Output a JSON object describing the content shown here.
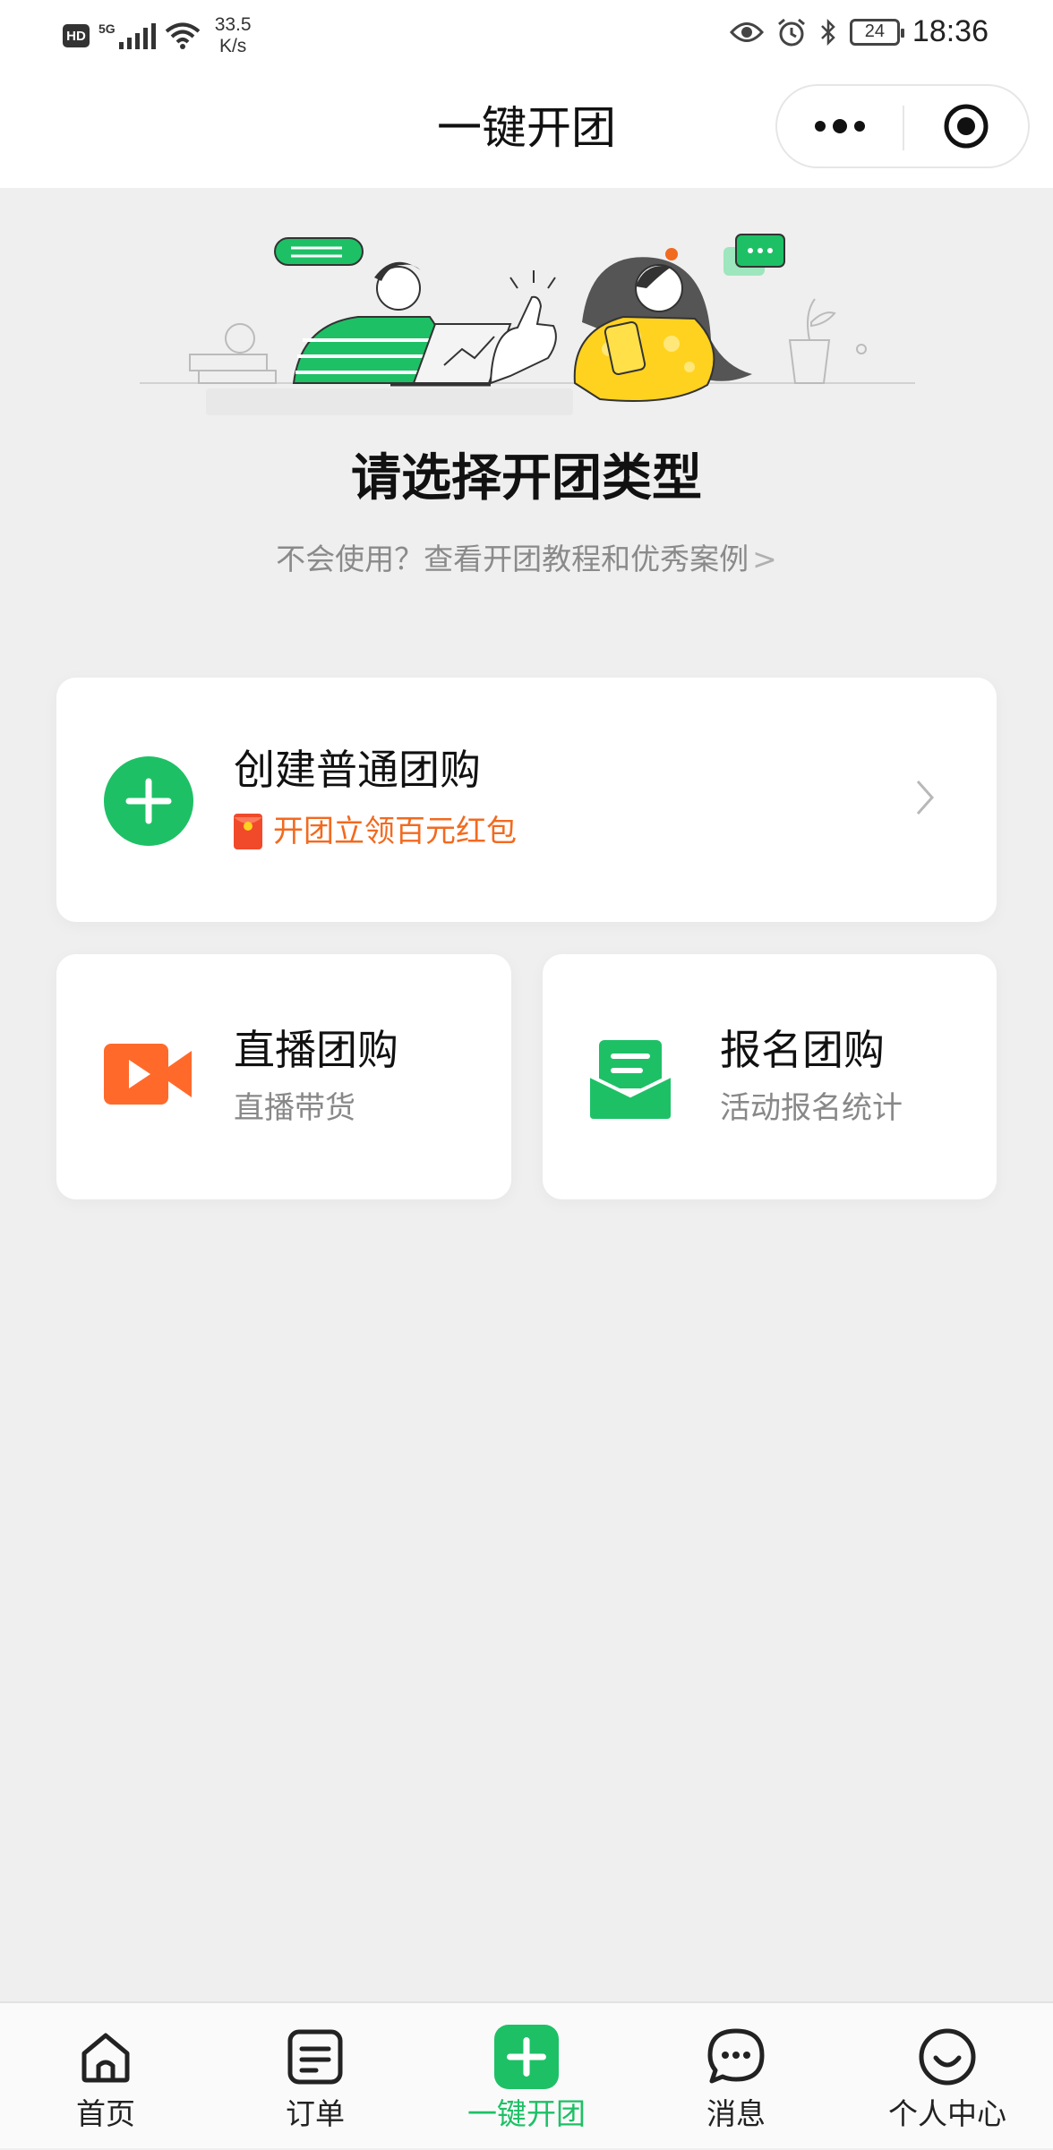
{
  "status_bar": {
    "hd": "HD",
    "network": "5G",
    "speed_value": "33.5",
    "speed_unit": "K/s",
    "battery": "24",
    "time": "18:36"
  },
  "header": {
    "title": "一键开团"
  },
  "hero": {
    "title": "请选择开团类型",
    "subtitle": "不会使用？查看开团教程和优秀案例",
    "subtitle_chevron": ">"
  },
  "cards": {
    "normal": {
      "title": "创建普通团购",
      "promo": "开团立领百元红包"
    },
    "live": {
      "title": "直播团购",
      "desc": "直播带货"
    },
    "signup": {
      "title": "报名团购",
      "desc": "活动报名统计"
    }
  },
  "tabbar": {
    "items": [
      {
        "label": "首页",
        "icon": "home-icon"
      },
      {
        "label": "订单",
        "icon": "order-icon"
      },
      {
        "label": "一键开团",
        "icon": "plus-square-icon",
        "active": true
      },
      {
        "label": "消息",
        "icon": "message-icon"
      },
      {
        "label": "个人中心",
        "icon": "profile-icon"
      }
    ]
  },
  "colors": {
    "accent_green": "#1ec066",
    "promo_orange": "#f26a1f",
    "live_icon_orange": "#ff6a2b",
    "background": "#efefef"
  }
}
